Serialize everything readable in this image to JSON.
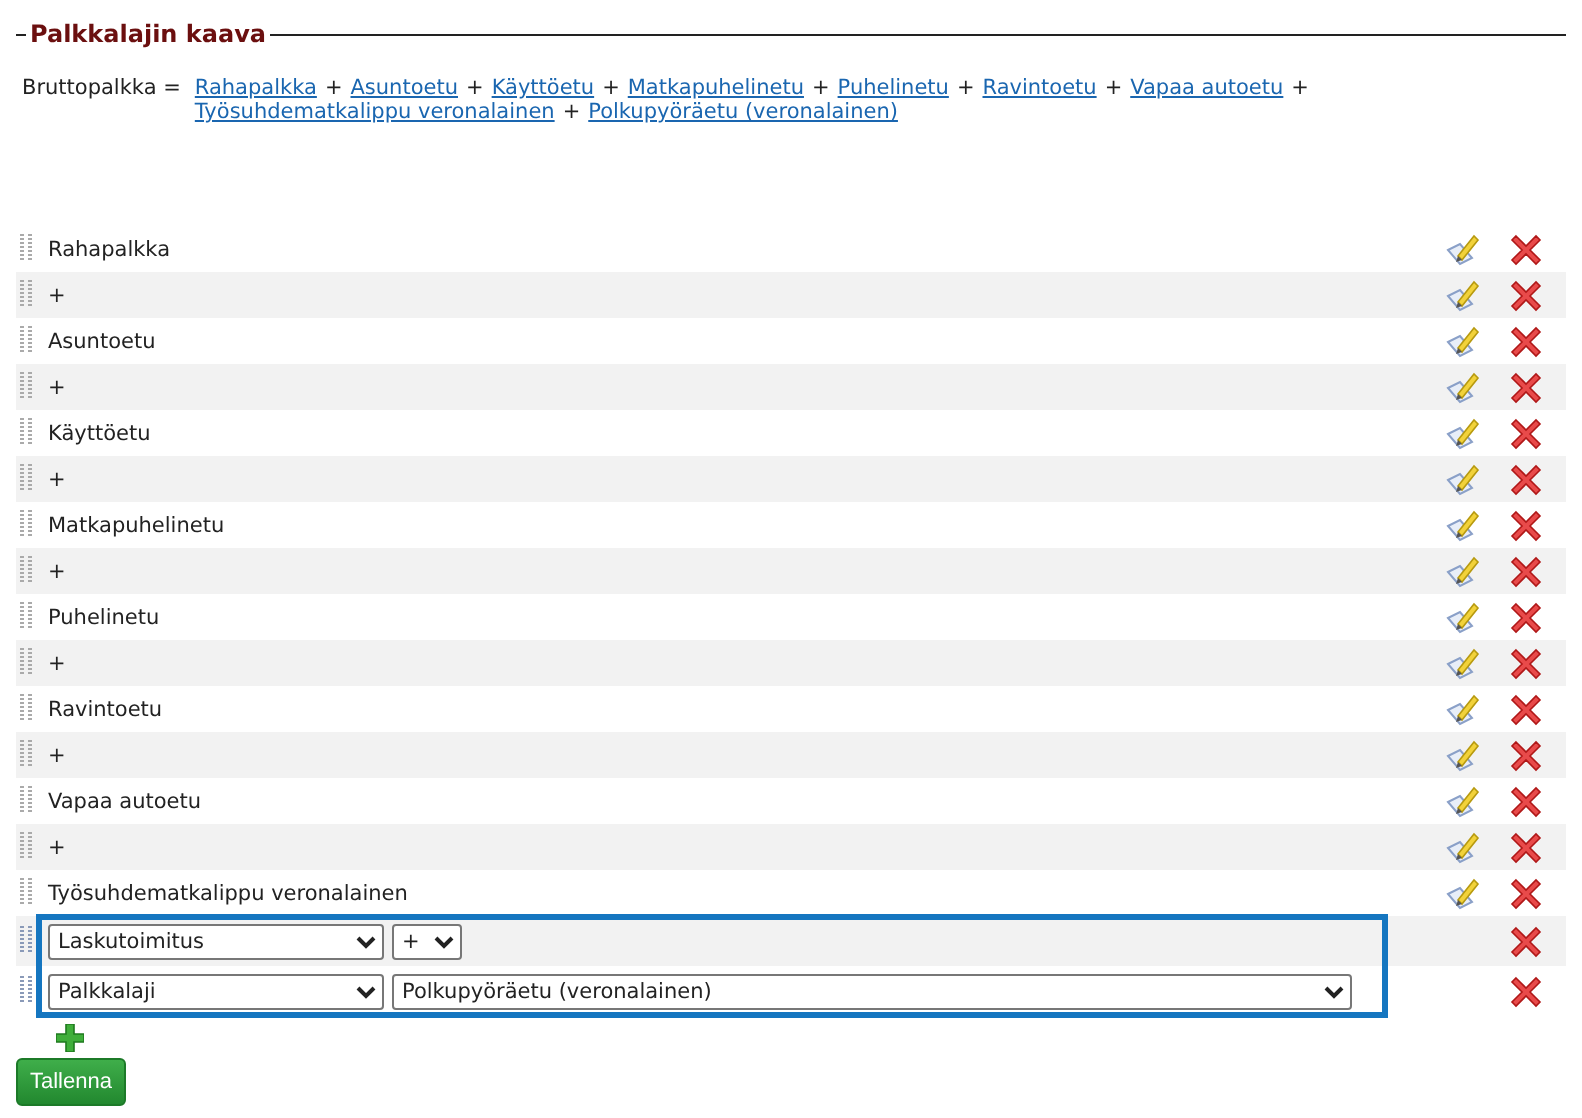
{
  "section": {
    "title": "Palkkalajin kaava"
  },
  "formula": {
    "label": "Bruttopalkka =",
    "terms": [
      {
        "kind": "link",
        "text": "Rahapalkka"
      },
      {
        "kind": "operator",
        "text": "+"
      },
      {
        "kind": "link",
        "text": "Asuntoetu"
      },
      {
        "kind": "operator",
        "text": "+"
      },
      {
        "kind": "link",
        "text": "Käyttöetu"
      },
      {
        "kind": "operator",
        "text": "+"
      },
      {
        "kind": "link",
        "text": "Matkapuhelinetu"
      },
      {
        "kind": "operator",
        "text": "+"
      },
      {
        "kind": "link",
        "text": "Puhelinetu"
      },
      {
        "kind": "operator",
        "text": "+"
      },
      {
        "kind": "link",
        "text": "Ravintoetu"
      },
      {
        "kind": "operator",
        "text": "+"
      },
      {
        "kind": "link",
        "text": "Vapaa autoetu"
      },
      {
        "kind": "operator",
        "text": "+"
      },
      {
        "kind": "link",
        "text": "Työsuhdematkalippu veronalainen"
      },
      {
        "kind": "operator",
        "text": "+"
      },
      {
        "kind": "link",
        "text": "Polkupyöräetu (veronalainen)"
      }
    ]
  },
  "rows": [
    {
      "text": "Rahapalkka"
    },
    {
      "text": "+"
    },
    {
      "text": "Asuntoetu"
    },
    {
      "text": "+"
    },
    {
      "text": "Käyttöetu"
    },
    {
      "text": "+"
    },
    {
      "text": "Matkapuhelinetu"
    },
    {
      "text": "+"
    },
    {
      "text": "Puhelinetu"
    },
    {
      "text": "+"
    },
    {
      "text": "Ravintoetu"
    },
    {
      "text": "+"
    },
    {
      "text": "Vapaa autoetu"
    },
    {
      "text": "+"
    },
    {
      "text": "Työsuhdematkalippu veronalainen"
    }
  ],
  "editor_rows": [
    {
      "selects": [
        {
          "kind": "type",
          "value": "Laskutoimitus"
        },
        {
          "kind": "operator",
          "value": "+"
        }
      ]
    },
    {
      "selects": [
        {
          "kind": "type",
          "value": "Palkkalaji"
        },
        {
          "kind": "item",
          "value": "Polkupyöräetu (veronalainen)"
        }
      ]
    }
  ],
  "save_button": "Tallenna"
}
